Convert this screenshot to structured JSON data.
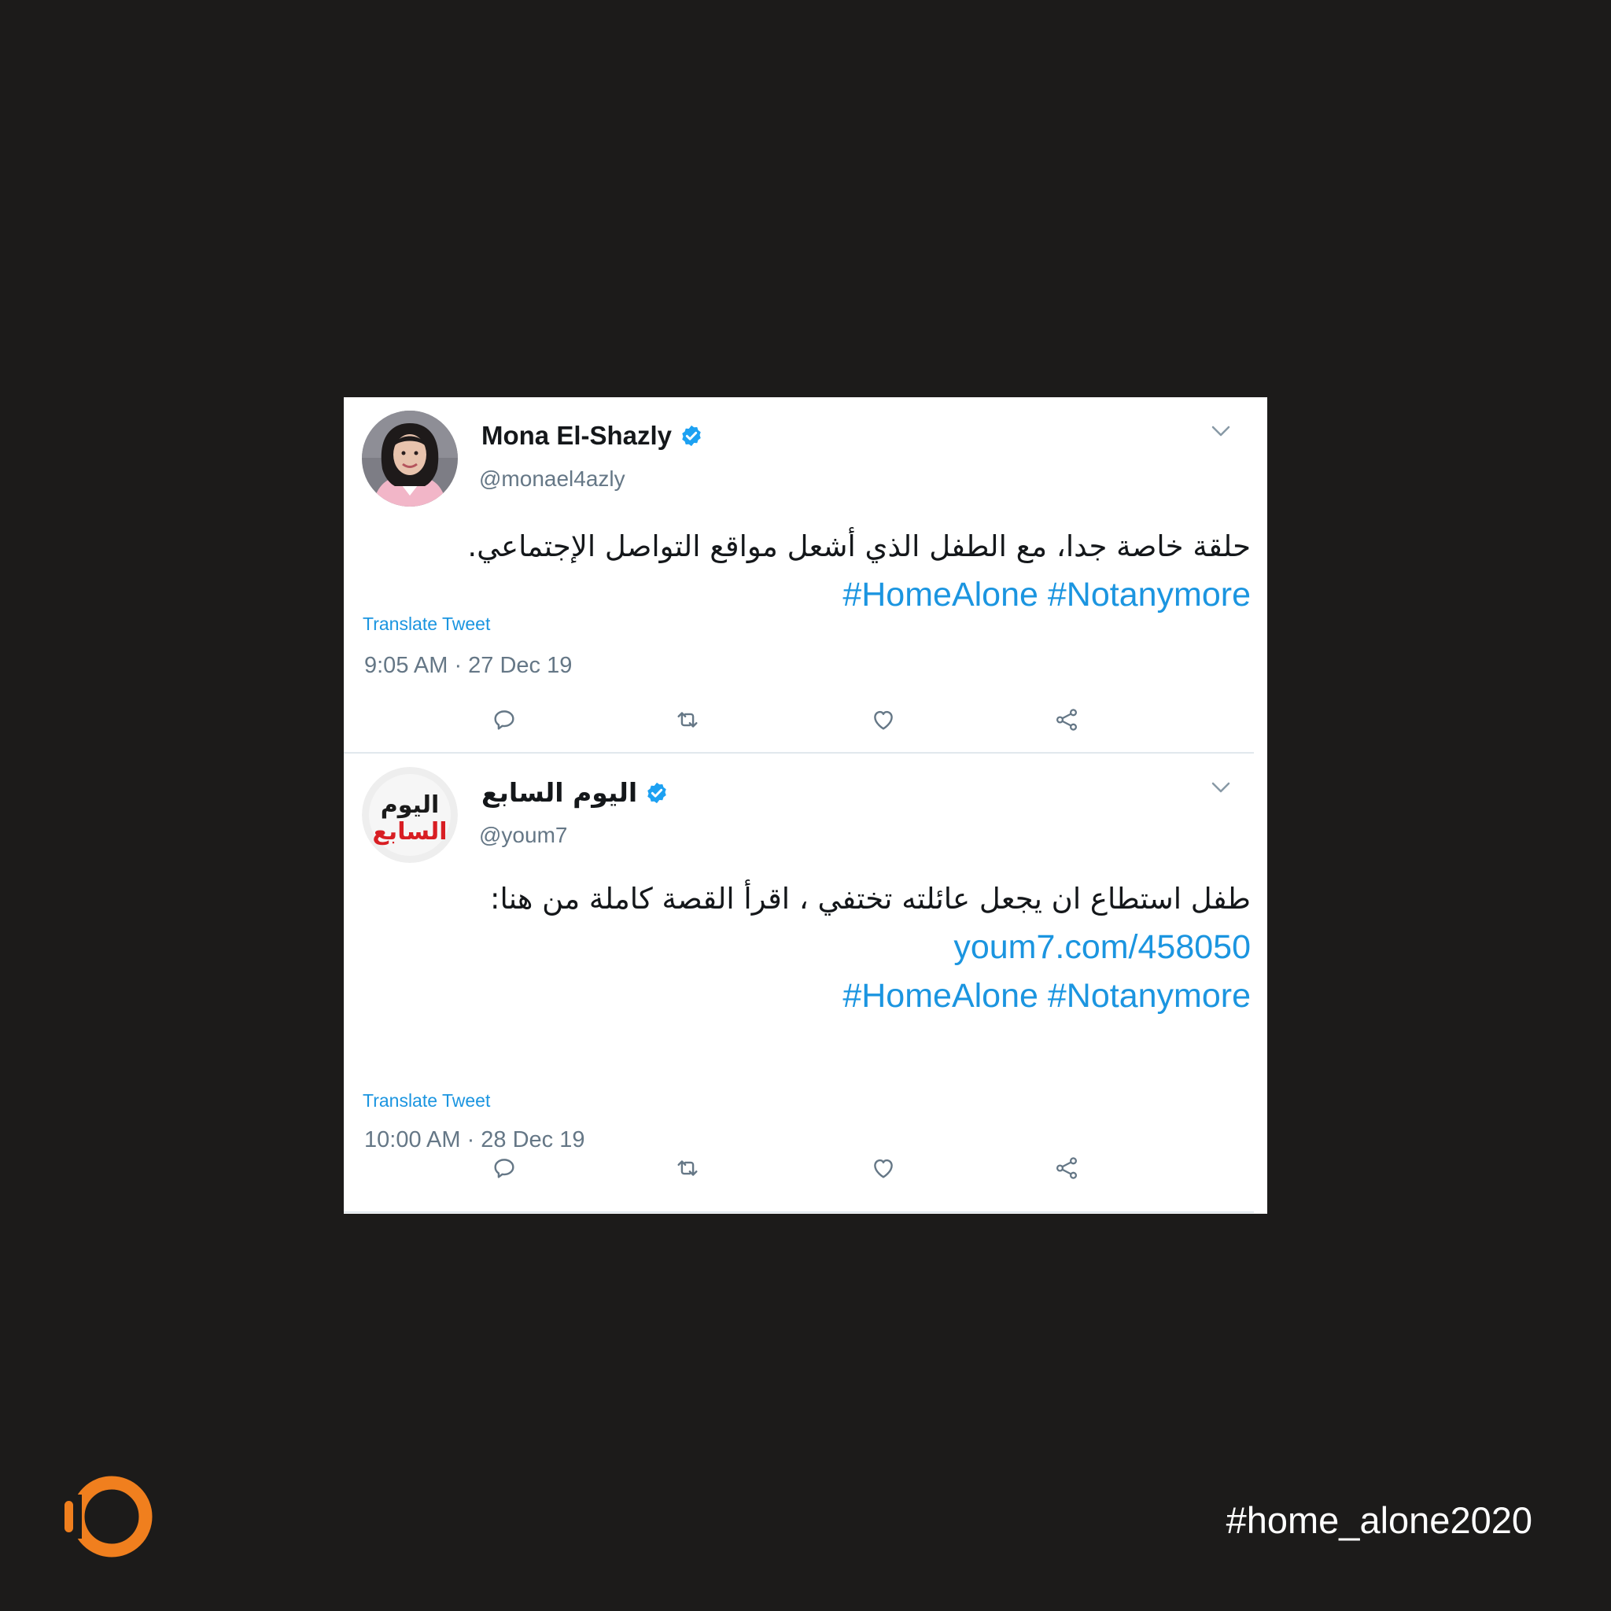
{
  "tweets": [
    {
      "display_name": "Mona El-Shazly",
      "handle": "@monael4azly",
      "text": "حلقة خاصة جدا، مع الطفل الذي أشعل مواقع التواصل الإجتماعي.",
      "link": "",
      "hashtags": "#HomeAlone #Notanymore",
      "translate_label": "Translate Tweet",
      "timestamp": "9:05 AM · 27 Dec 19",
      "avatar_icon": "woman-portrait-avatar"
    },
    {
      "display_name": "اليوم السابع",
      "handle": "@youm7",
      "text": "طفل استطاع ان يجعل عائلته تختفي ، اقرأ القصة كاملة من هنا:",
      "link": "youm7.com/458050",
      "hashtags": "#HomeAlone #Notanymore",
      "translate_label": "Translate Tweet",
      "timestamp": "10:00 AM · 28 Dec 19",
      "avatar_icon": "youm7-logo-avatar",
      "avatar_logo_text": "اليوم السابع"
    }
  ],
  "actions": [
    "reply-icon",
    "retweet-icon",
    "like-icon",
    "share-icon"
  ],
  "page_hashtag": "#home_alone2020",
  "colors": {
    "background": "#1c1b1a",
    "card": "#ffffff",
    "link": "#1b95e0",
    "verified": "#1da1f2",
    "secondary_text": "#657786",
    "brand_orange": "#f07f1e"
  }
}
